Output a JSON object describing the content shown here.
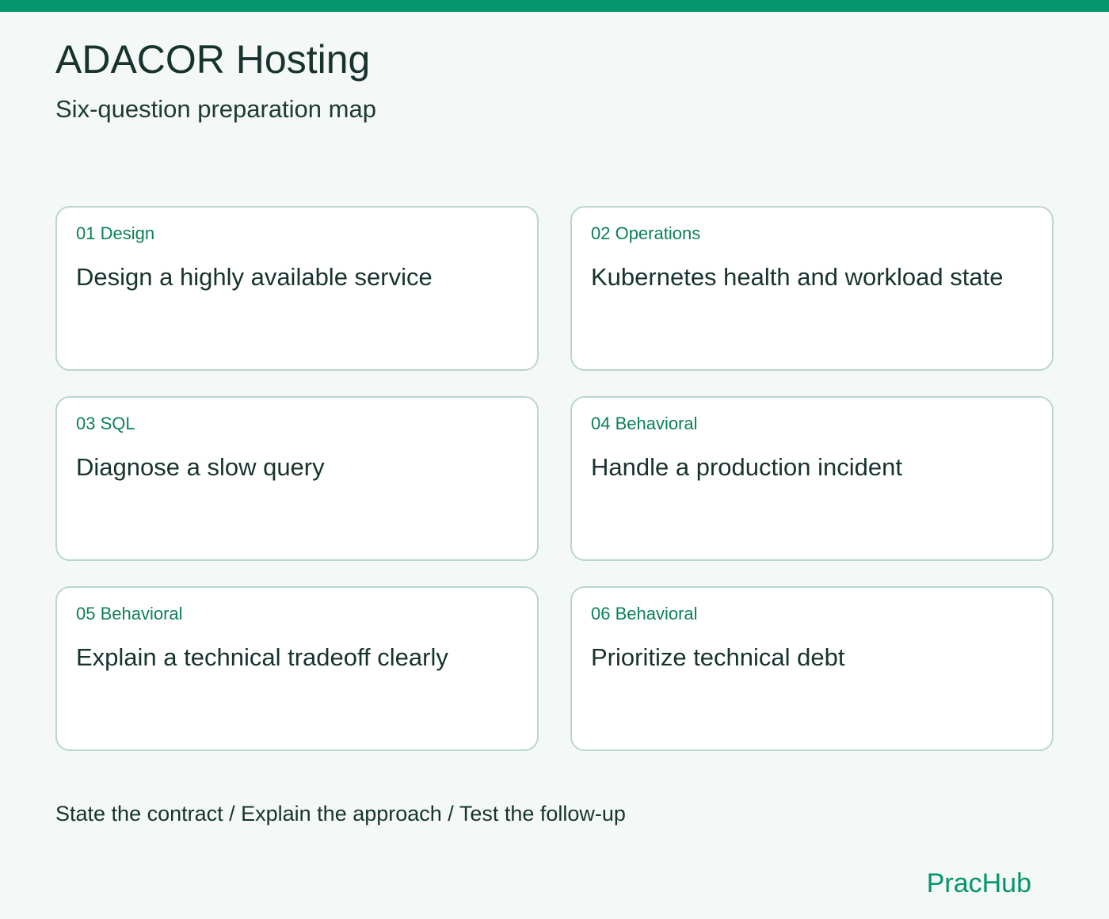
{
  "colors": {
    "accent": "#05956b",
    "label": "#0b7f5c",
    "text": "#17332e",
    "background": "#f4f8f6",
    "card_border": "#b9d7cc",
    "card_background": "#ffffff"
  },
  "header": {
    "title": "ADACOR Hosting",
    "subtitle": "Six-question preparation map"
  },
  "cards": [
    {
      "label": "01 Design",
      "question": "Design a highly available service"
    },
    {
      "label": "02 Operations",
      "question": "Kubernetes health and workload state"
    },
    {
      "label": "03 SQL",
      "question": "Diagnose a slow query"
    },
    {
      "label": "04 Behavioral",
      "question": "Handle a production incident"
    },
    {
      "label": "05 Behavioral",
      "question": "Explain a technical tradeoff clearly"
    },
    {
      "label": "06 Behavioral",
      "question": "Prioritize technical debt"
    }
  ],
  "footer": {
    "text": "State the contract / Explain the approach / Test the follow-up",
    "brand": "PracHub"
  }
}
